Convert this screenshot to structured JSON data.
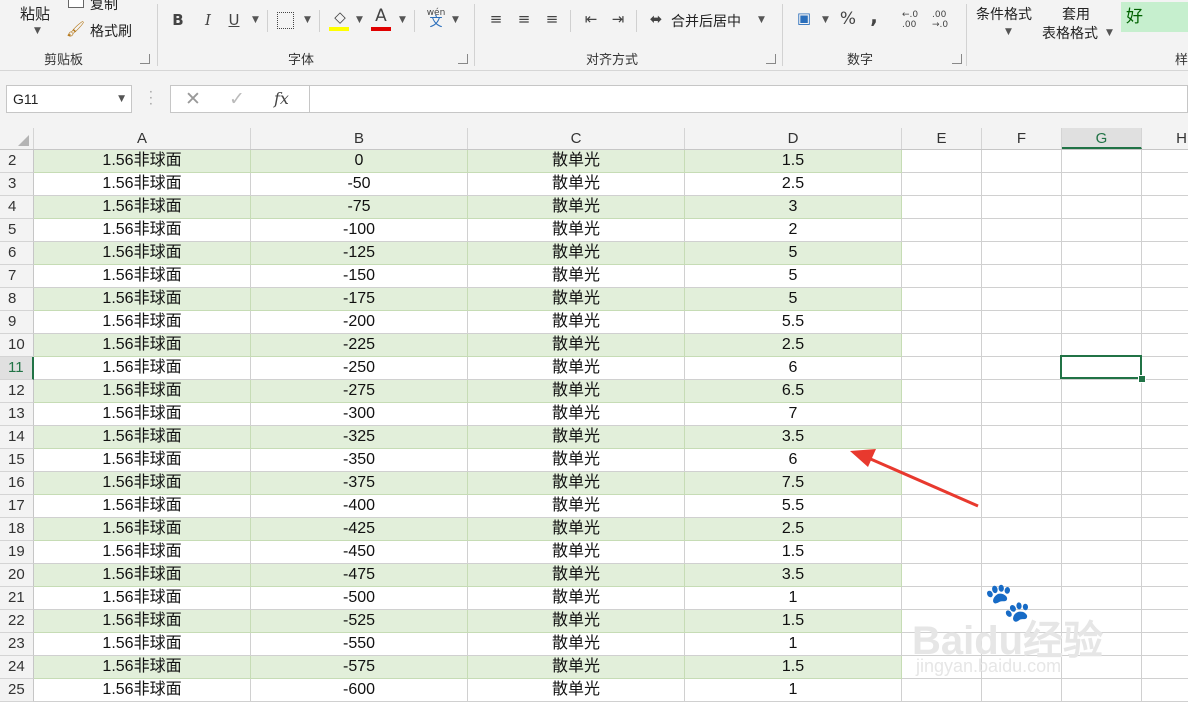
{
  "ribbon": {
    "clipboard": {
      "paste": "粘贴",
      "copy": "复制",
      "format_painter": "格式刷",
      "group": "剪贴板"
    },
    "font": {
      "group": "字体",
      "bold": "B",
      "italic": "I",
      "underline": "U",
      "font_color_letter": "A",
      "phonetic": "wén",
      "phonetic_sub": "文"
    },
    "alignment": {
      "merge_center": "合并后居中",
      "group": "对齐方式"
    },
    "number": {
      "percent": "%",
      "comma": ",",
      "inc_decimal": "←.0 .00",
      "group": "数字"
    },
    "styles": {
      "conditional": "条件格式",
      "table_format_1": "套用",
      "table_format_2": "表格格式",
      "good": "好",
      "group_partial": "样"
    }
  },
  "formula_bar": {
    "name_box": "G11",
    "fx": "fx",
    "value": ""
  },
  "columns": [
    "A",
    "B",
    "C",
    "D",
    "E",
    "F",
    "G",
    "H"
  ],
  "selected_cell": "G11",
  "rows": [
    {
      "n": "2",
      "a": "1.56非球面",
      "b": "0",
      "c": "散单光",
      "d": "1.5"
    },
    {
      "n": "3",
      "a": "1.56非球面",
      "b": "-50",
      "c": "散单光",
      "d": "2.5"
    },
    {
      "n": "4",
      "a": "1.56非球面",
      "b": "-75",
      "c": "散单光",
      "d": "3"
    },
    {
      "n": "5",
      "a": "1.56非球面",
      "b": "-100",
      "c": "散单光",
      "d": "2"
    },
    {
      "n": "6",
      "a": "1.56非球面",
      "b": "-125",
      "c": "散单光",
      "d": "5"
    },
    {
      "n": "7",
      "a": "1.56非球面",
      "b": "-150",
      "c": "散单光",
      "d": "5"
    },
    {
      "n": "8",
      "a": "1.56非球面",
      "b": "-175",
      "c": "散单光",
      "d": "5"
    },
    {
      "n": "9",
      "a": "1.56非球面",
      "b": "-200",
      "c": "散单光",
      "d": "5.5"
    },
    {
      "n": "10",
      "a": "1.56非球面",
      "b": "-225",
      "c": "散单光",
      "d": "2.5"
    },
    {
      "n": "11",
      "a": "1.56非球面",
      "b": "-250",
      "c": "散单光",
      "d": "6"
    },
    {
      "n": "12",
      "a": "1.56非球面",
      "b": "-275",
      "c": "散单光",
      "d": "6.5"
    },
    {
      "n": "13",
      "a": "1.56非球面",
      "b": "-300",
      "c": "散单光",
      "d": "7"
    },
    {
      "n": "14",
      "a": "1.56非球面",
      "b": "-325",
      "c": "散单光",
      "d": "3.5"
    },
    {
      "n": "15",
      "a": "1.56非球面",
      "b": "-350",
      "c": "散单光",
      "d": "6"
    },
    {
      "n": "16",
      "a": "1.56非球面",
      "b": "-375",
      "c": "散单光",
      "d": "7.5"
    },
    {
      "n": "17",
      "a": "1.56非球面",
      "b": "-400",
      "c": "散单光",
      "d": "5.5"
    },
    {
      "n": "18",
      "a": "1.56非球面",
      "b": "-425",
      "c": "散单光",
      "d": "2.5"
    },
    {
      "n": "19",
      "a": "1.56非球面",
      "b": "-450",
      "c": "散单光",
      "d": "1.5"
    },
    {
      "n": "20",
      "a": "1.56非球面",
      "b": "-475",
      "c": "散单光",
      "d": "3.5"
    },
    {
      "n": "21",
      "a": "1.56非球面",
      "b": "-500",
      "c": "散单光",
      "d": "1"
    },
    {
      "n": "22",
      "a": "1.56非球面",
      "b": "-525",
      "c": "散单光",
      "d": "1.5"
    },
    {
      "n": "23",
      "a": "1.56非球面",
      "b": "-550",
      "c": "散单光",
      "d": "1"
    },
    {
      "n": "24",
      "a": "1.56非球面",
      "b": "-575",
      "c": "散单光",
      "d": "1.5"
    },
    {
      "n": "25",
      "a": "1.56非球面",
      "b": "-600",
      "c": "散单光",
      "d": "1"
    }
  ],
  "watermark": {
    "brand": "Baidu经验",
    "url": "jingyan.baidu.com"
  },
  "colors": {
    "band_green": "#e2efda",
    "excel_green": "#217346",
    "arrow_red": "#e8392e"
  }
}
